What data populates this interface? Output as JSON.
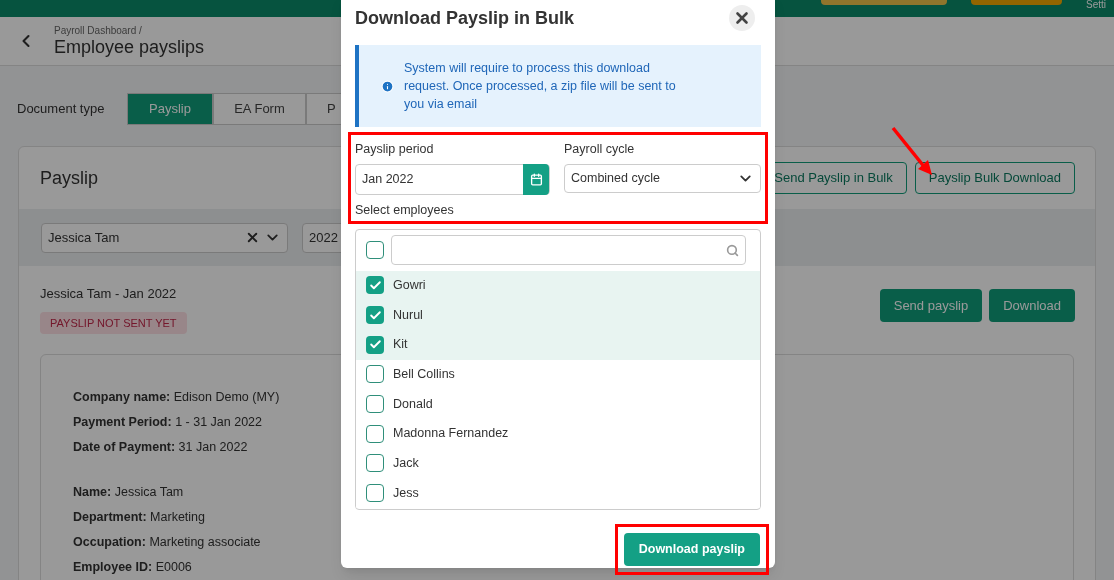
{
  "top_bar": {
    "settings_label": "Setti"
  },
  "header": {
    "breadcrumb": "Payroll Dashboard /",
    "title": "Employee payslips"
  },
  "document_type": {
    "label": "Document type",
    "tabs": [
      {
        "label": "Payslip",
        "selected": true
      },
      {
        "label": "EA Form",
        "selected": false
      },
      {
        "label": "P",
        "selected": false
      }
    ]
  },
  "card": {
    "title": "Payslip",
    "buttons": [
      "Send Payslip in Bulk",
      "Payslip Bulk Download"
    ],
    "filters": {
      "employee": "Jessica Tam",
      "year": "2022"
    },
    "payslip": {
      "heading": "Jessica Tam - Jan 2022",
      "status": "PAYSLIP NOT SENT YET",
      "buttons": [
        "Send payslip",
        "Download"
      ],
      "details": [
        [
          {
            "label": "Company name:",
            "value": "Edison Demo (MY)"
          },
          {
            "label": "Payment Period:",
            "value": "1 - 31 Jan 2022"
          },
          {
            "label": "Date of Payment:",
            "value": "31 Jan 2022"
          }
        ],
        [
          {
            "label": "Name:",
            "value": "Jessica Tam"
          },
          {
            "label": "Department:",
            "value": "Marketing"
          },
          {
            "label": "Occupation:",
            "value": "Marketing associate"
          },
          {
            "label": "Employee ID:",
            "value": "E0006"
          }
        ]
      ]
    }
  },
  "dialog": {
    "title": "Download Payslip in Bulk",
    "info": "System will require to process this download request. Once processed, a zip file will be sent to you via email",
    "payslip_period": {
      "label": "Payslip period",
      "value": "Jan 2022"
    },
    "payroll_cycle": {
      "label": "Payroll cycle",
      "value": "Combined cycle"
    },
    "select_label": "Select employees",
    "select_all_checked": false,
    "employees": [
      {
        "name": "Gowri",
        "checked": true
      },
      {
        "name": "Nurul",
        "checked": true
      },
      {
        "name": "Kit",
        "checked": true
      },
      {
        "name": "Bell Collins",
        "checked": false
      },
      {
        "name": "Donald",
        "checked": false
      },
      {
        "name": "Madonna Fernandez",
        "checked": false
      },
      {
        "name": "Jack",
        "checked": false
      },
      {
        "name": "Jess",
        "checked": false
      }
    ],
    "submit": "Download payslip"
  }
}
